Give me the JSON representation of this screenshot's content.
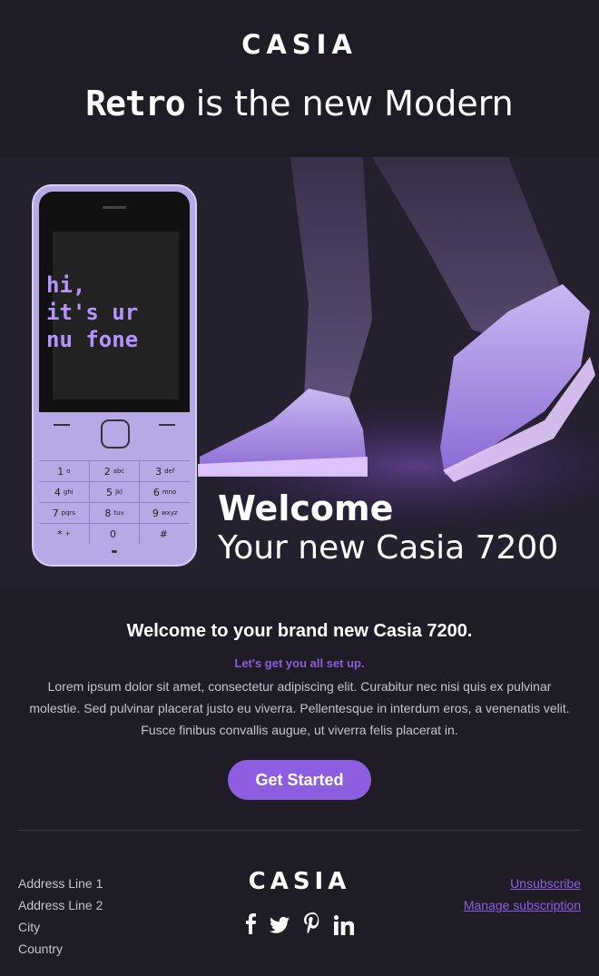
{
  "header": {
    "brand": "CASIA",
    "tagline_retro": "Retro",
    "tagline_rest": " is the new Modern"
  },
  "hero": {
    "phone_screen_text": "hi,\nit's ur\nnu fone",
    "title": "Welcome",
    "subtitle": "Your new Casia 7200",
    "keypad": [
      [
        {
          "n": "1",
          "l": "o"
        },
        {
          "n": "2",
          "l": "abc"
        },
        {
          "n": "3",
          "l": "def"
        }
      ],
      [
        {
          "n": "4",
          "l": "ghi"
        },
        {
          "n": "5",
          "l": "jkl"
        },
        {
          "n": "6",
          "l": "mno"
        }
      ],
      [
        {
          "n": "7",
          "l": "pqrs"
        },
        {
          "n": "8",
          "l": "tuv"
        },
        {
          "n": "9",
          "l": "wxyz"
        }
      ],
      [
        {
          "n": "*",
          "l": "+"
        },
        {
          "n": "0",
          "l": ""
        },
        {
          "n": "#",
          "l": ""
        }
      ]
    ]
  },
  "content": {
    "heading": "Welcome to your brand new Casia 7200.",
    "subhead": "Let's get you all set up.",
    "body": "Lorem ipsum dolor sit amet, consectetur adipiscing elit. Curabitur nec nisi quis ex pulvinar molestie. Sed pulvinar placerat justo eu viverra. Pellentesque in interdum eros, a venenatis velit. Fusce finibus convallis augue, ut viverra felis placerat in.",
    "cta_label": "Get Started"
  },
  "footer": {
    "address": [
      "Address Line 1",
      "Address Line 2",
      "City",
      "Country"
    ],
    "brand": "CASIA",
    "social_icons": [
      "facebook-icon",
      "twitter-icon",
      "pinterest-icon",
      "linkedin-icon"
    ],
    "unsubscribe": "Unsubscribe",
    "manage": "Manage subscription"
  },
  "colors": {
    "background": "#1f1c26",
    "accent": "#8d5fe0",
    "phone": "#b7a8e6",
    "text_muted": "#c7c4cd"
  }
}
